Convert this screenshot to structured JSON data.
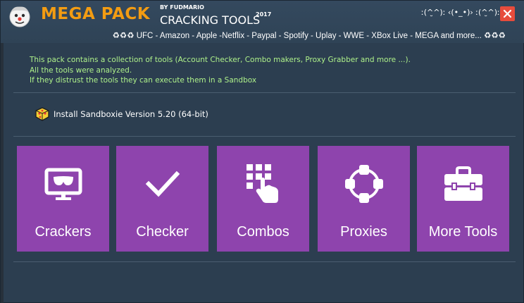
{
  "header": {
    "title": "MEGA PACK",
    "by": "BY FUDMARIO",
    "subtitle": "CRACKING TOOLS",
    "year": "2017",
    "kaomoji": "ː(^̮^)ː ‹(•_•)› ː(^̮^)ː",
    "close_icon": "close-icon"
  },
  "services_line": "♻♻♻ UFC - Amazon - Apple -Netflix - Paypal - Spotify - Uplay - WWE - XBox Live - MEGA and more... ♻♻♻",
  "notice": {
    "lines": [
      "This pack contains a collection of tools (Account Checker, Combo makers, Proxy Grabber and more ...).",
      "All the tools were analyzed.",
      "If they distrust the tools they can execute them in a Sandbox"
    ]
  },
  "sandbox": {
    "label": "Install Sandboxie Version 5.20 (64-bit)",
    "icon": "sandboxie-icon"
  },
  "tiles": [
    {
      "label": "Crackers",
      "icon": "monitor-mask-icon"
    },
    {
      "label": "Checker",
      "icon": "checkmark-icon"
    },
    {
      "label": "Combos",
      "icon": "grid-touch-icon"
    },
    {
      "label": "Proxies",
      "icon": "network-ring-icon"
    },
    {
      "label": "More Tools",
      "icon": "toolbox-icon"
    }
  ],
  "colors": {
    "background": "#2c3e50",
    "title": "#f39c12",
    "notice_text": "#aef18a",
    "tile": "#8e44ad",
    "close": "#e74c3c"
  }
}
